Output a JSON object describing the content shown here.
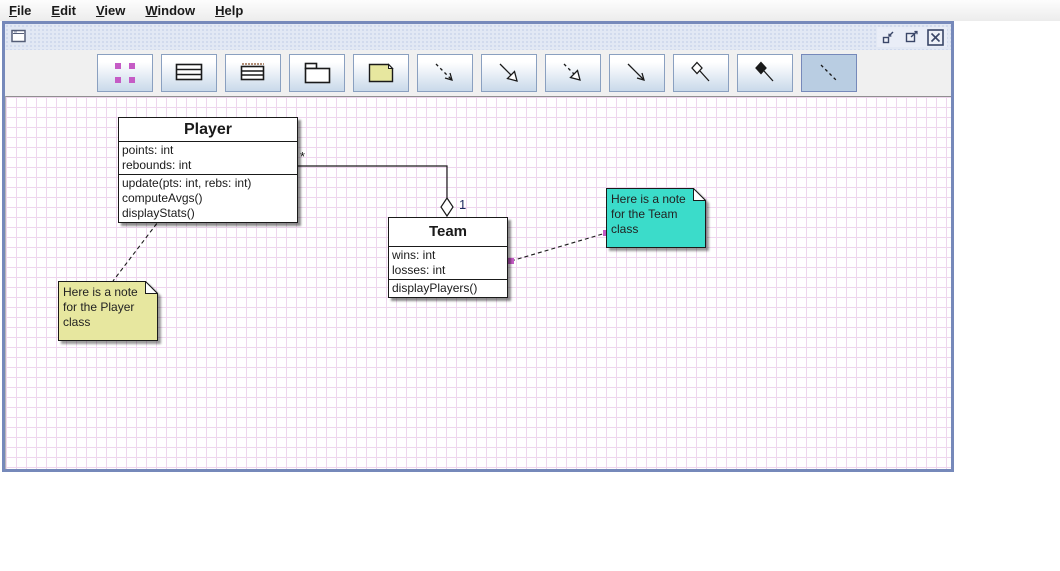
{
  "menu": {
    "items": [
      {
        "label": "File"
      },
      {
        "label": "Edit"
      },
      {
        "label": "View"
      },
      {
        "label": "Window"
      },
      {
        "label": "Help"
      }
    ]
  },
  "frame": {
    "titlebar_controls": [
      {
        "name": "minimize"
      },
      {
        "name": "maximize"
      },
      {
        "name": "close"
      }
    ]
  },
  "toolbar": {
    "tools": [
      {
        "name": "selection-tool",
        "icon": "grabber-dots-icon",
        "selected": false
      },
      {
        "name": "class-node-tool",
        "icon": "class-box-icon",
        "selected": false
      },
      {
        "name": "interface-node-tool",
        "icon": "interface-box-icon",
        "selected": false
      },
      {
        "name": "package-node-tool",
        "icon": "package-folder-icon",
        "selected": false
      },
      {
        "name": "note-node-tool",
        "icon": "sticky-note-icon",
        "selected": false
      },
      {
        "name": "dependency-edge-tool",
        "icon": "dashed-open-arrow-icon",
        "selected": false
      },
      {
        "name": "inheritance-edge-tool",
        "icon": "solid-triangle-arrow-icon",
        "selected": false
      },
      {
        "name": "realization-edge-tool",
        "icon": "dashed-triangle-arrow-icon",
        "selected": false
      },
      {
        "name": "association-edge-tool",
        "icon": "solid-open-arrow-icon",
        "selected": false
      },
      {
        "name": "aggregation-edge-tool",
        "icon": "hollow-diamond-edge-icon",
        "selected": false
      },
      {
        "name": "composition-edge-tool",
        "icon": "filled-diamond-edge-icon",
        "selected": false
      },
      {
        "name": "note-connector-tool",
        "icon": "dashed-line-icon",
        "selected": true
      }
    ]
  },
  "diagram": {
    "classes": [
      {
        "name": "Player",
        "fields": [
          "points: int",
          "rebounds: int"
        ],
        "methods": [
          "update(pts: int, rebs: int)",
          "computeAvgs()",
          "displayStats()"
        ]
      },
      {
        "name": "Team",
        "fields": [
          "wins: int",
          "losses: int"
        ],
        "methods": [
          "displayPlayers()"
        ]
      }
    ],
    "notes": [
      {
        "text": "Here is a note for the Player class",
        "color": "#e7e79f"
      },
      {
        "text": "Here is a note for the Team class",
        "color": "#3bdcca"
      }
    ],
    "edges": [
      {
        "type": "aggregation",
        "from": "Player",
        "to": "Team",
        "source_label": "*",
        "target_label": "1"
      },
      {
        "type": "note-connector",
        "from": "Player",
        "to": "note-player"
      },
      {
        "type": "note-connector",
        "from": "Team",
        "to": "note-team",
        "selected": true
      }
    ]
  },
  "colors": {
    "grid_line": "#eed6ee",
    "selection_handle": "#c55bc5",
    "frame_border": "#7689ba",
    "toolbar_selected_bg": "#b9cde2",
    "note_player_bg": "#e7e79f",
    "note_team_bg": "#3bdcca"
  }
}
